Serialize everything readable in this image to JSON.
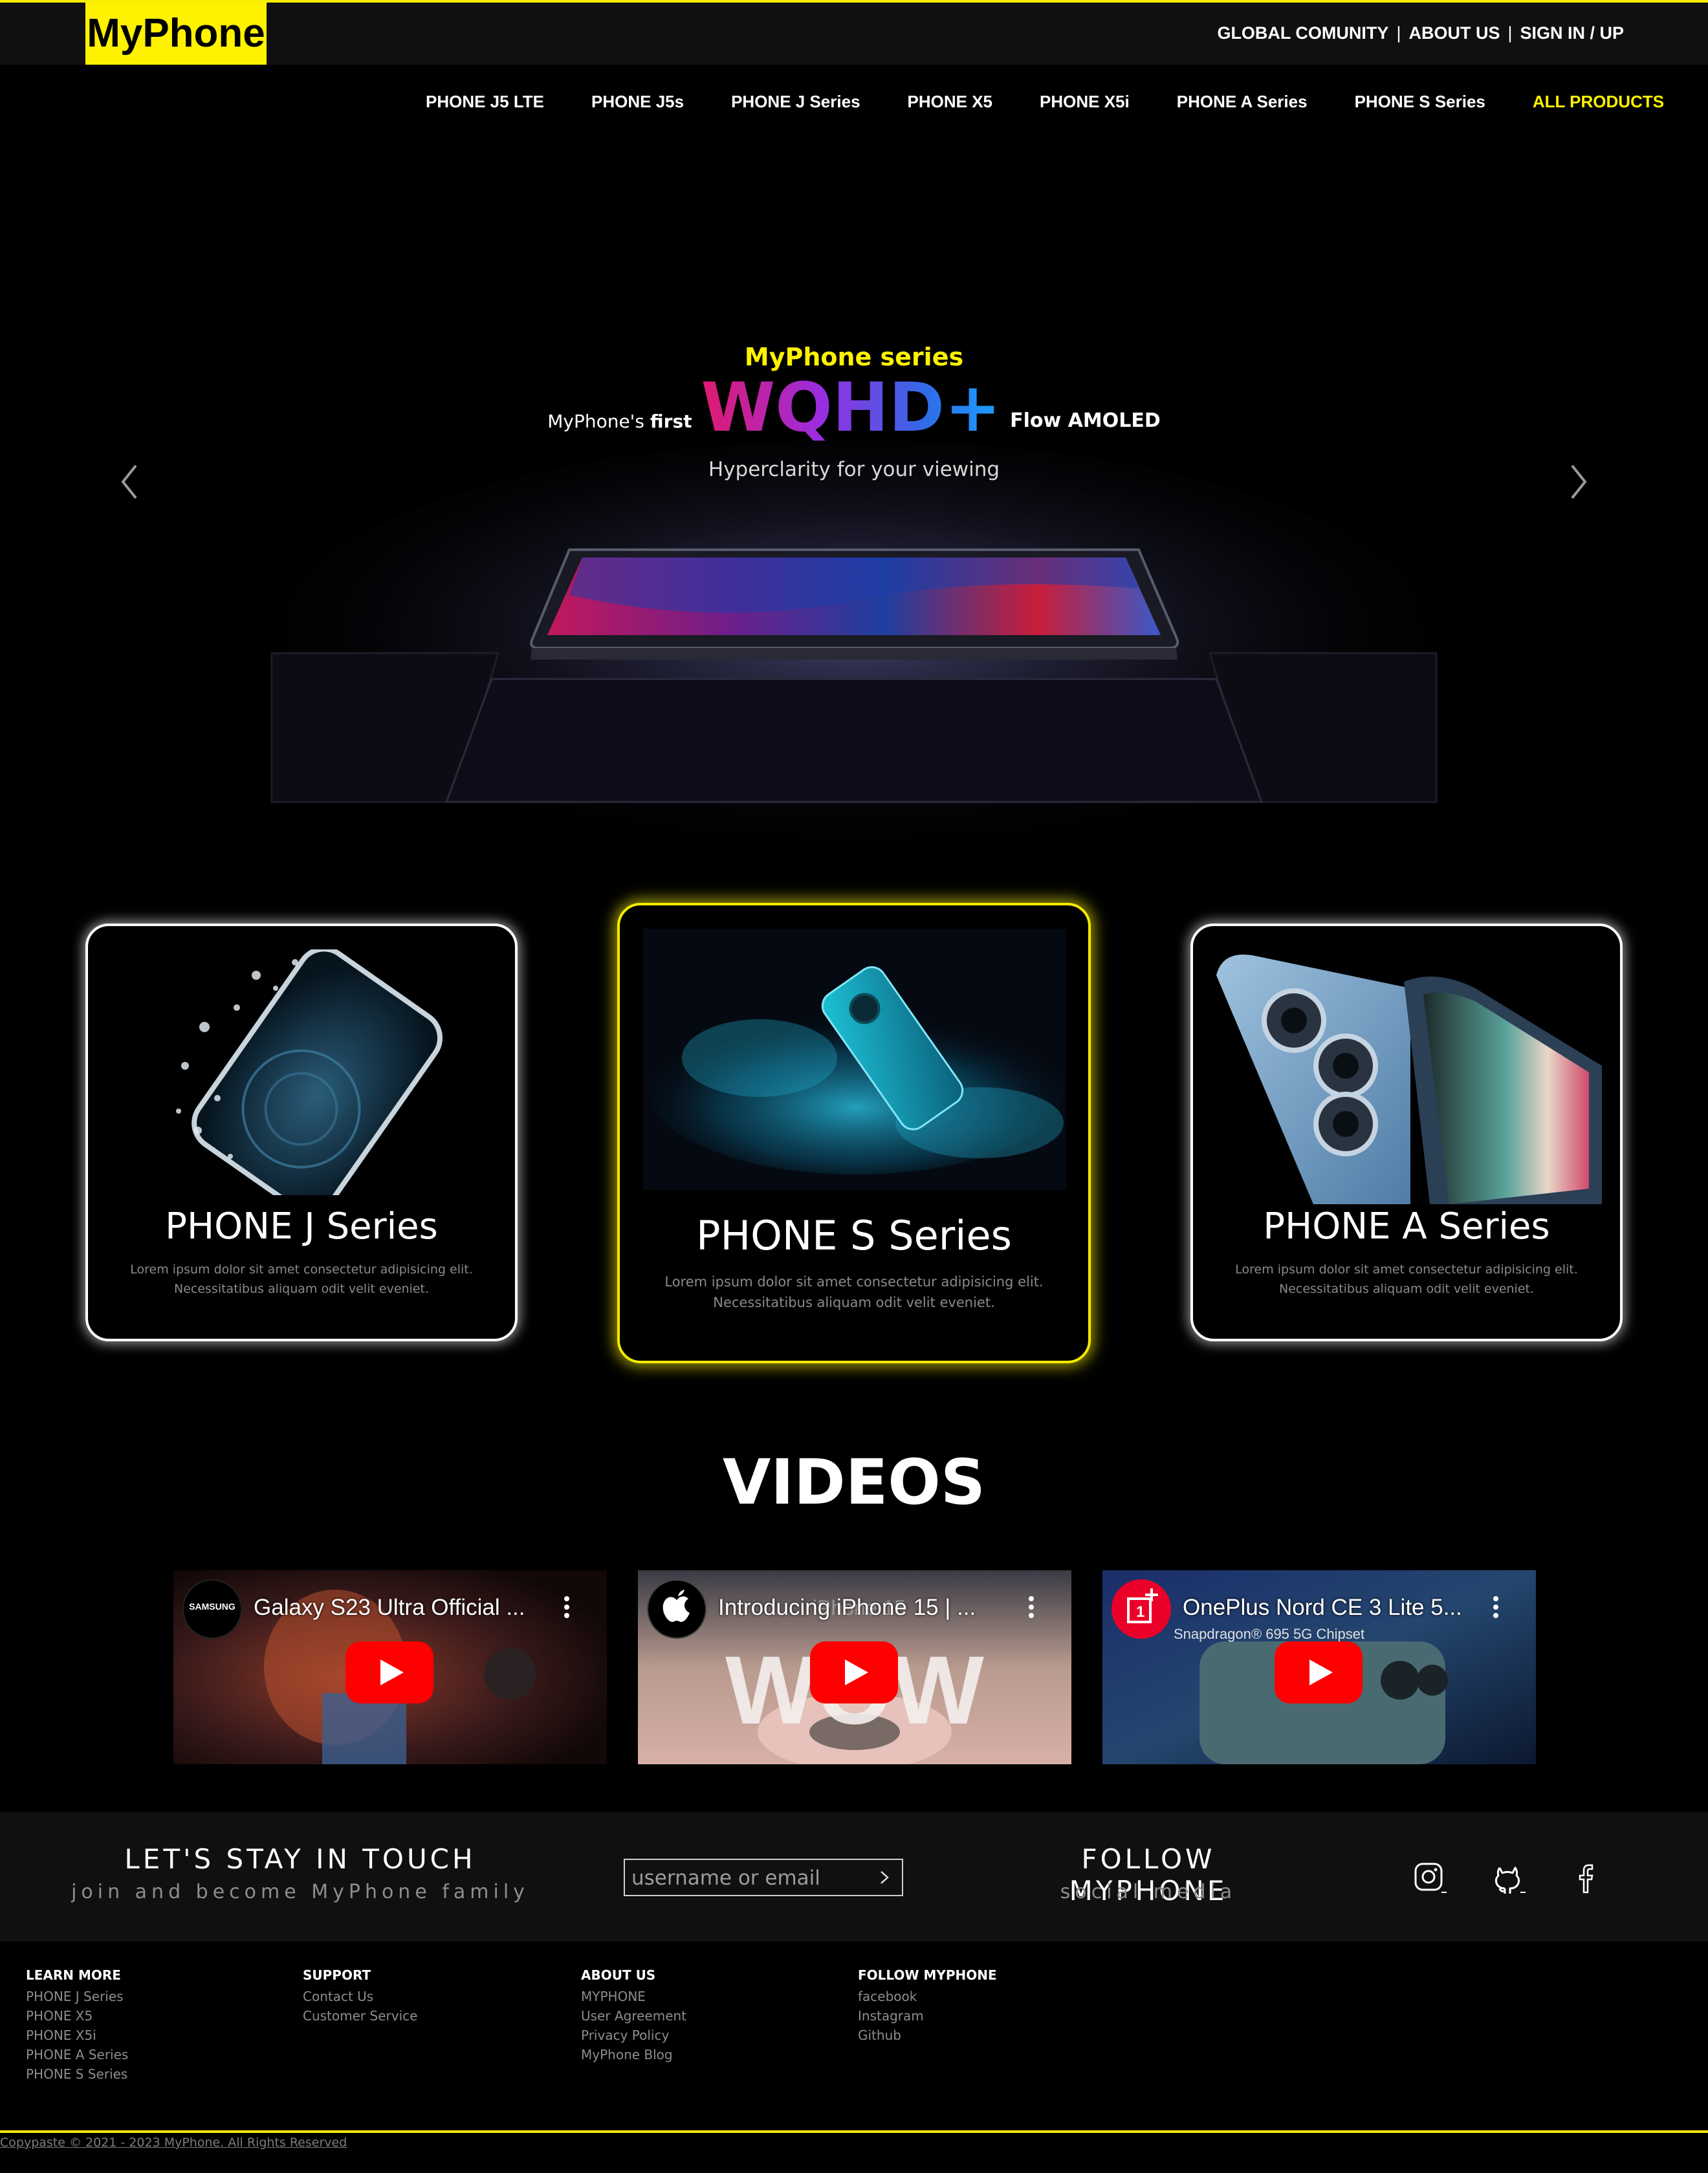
{
  "brand": {
    "logo": "MyPhone",
    "accent": "#fff200"
  },
  "toplinks": [
    "GLOBAL COMUNITY",
    "ABOUT US",
    "SIGN IN / UP"
  ],
  "toplinks_sep": "|",
  "nav": [
    "PHONE J5 LTE",
    "PHONE J5s",
    "PHONE J Series",
    "PHONE X5",
    "PHONE X5i",
    "PHONE A Series",
    "PHONE S Series",
    "ALL PRODUCTS"
  ],
  "hero": {
    "series": "MyPhone series",
    "first_prefix": "MyPhone's ",
    "first_bold": "first",
    "big": "WQHD+",
    "flow": "Flow AMOLED",
    "sub": "Hyperclarity for your viewing",
    "prev_icon": "chevron-left-icon",
    "next_icon": "chevron-right-icon"
  },
  "cards": [
    {
      "title": "PHONE J Series",
      "desc": "Lorem ipsum dolor sit amet consectetur adipisicing elit. Necessitatibus aliquam odit velit eveniet."
    },
    {
      "title": "PHONE S Series",
      "desc": "Lorem ipsum dolor sit amet consectetur adipisicing elit. Necessitatibus aliquam odit velit eveniet."
    },
    {
      "title": "PHONE A Series",
      "desc": "Lorem ipsum dolor sit amet consectetur adipisicing elit. Necessitatibus aliquam odit velit eveniet."
    }
  ],
  "videos_title": "VIDEOS",
  "videos": [
    {
      "title": "Galaxy S23 Ultra Official ...",
      "channel": "SAMSUNG"
    },
    {
      "title": "Introducing iPhone 15 | ...",
      "overlay_top": "iPhone 15",
      "overlay_big": "WOW"
    },
    {
      "title": "OnePlus Nord CE 3 Lite 5...",
      "overlay_small": "Snapdragon® 695 5G Chipset"
    }
  ],
  "newsletter": {
    "title": "LET'S STAY IN TOUCH",
    "subtitle": "join and become MyPhone family",
    "placeholder": "username or email"
  },
  "follow": {
    "title": "FOLLOW MYPHONE",
    "subtitle": "social media",
    "icons": [
      "instagram-icon",
      "github-icon",
      "facebook-icon"
    ]
  },
  "footer": {
    "learn": {
      "heading": "LEARN MORE",
      "links": [
        "PHONE J Series",
        "PHONE X5",
        "PHONE X5i",
        "PHONE A Series",
        "PHONE S Series"
      ]
    },
    "support": {
      "heading": "SUPPORT",
      "links": [
        "Contact Us",
        "Customer Service"
      ]
    },
    "about": {
      "heading": "ABOUT US",
      "links": [
        "MYPHONE",
        "User Agreement",
        "Privacy Policy",
        "MyPhone Blog"
      ]
    },
    "follow": {
      "heading": "FOLLOW MYPHONE",
      "links": [
        "facebook",
        "Instagram",
        "Github"
      ]
    }
  },
  "copyright": "Copypaste © 2021 - 2023 MyPhone. All Rights Reserved"
}
